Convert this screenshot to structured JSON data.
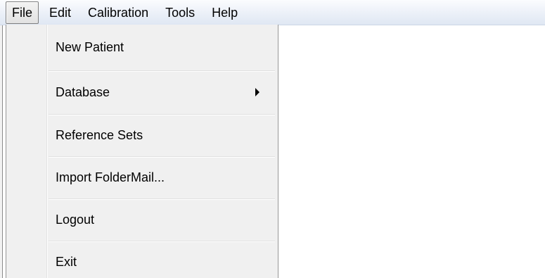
{
  "menubar": {
    "items": [
      {
        "label": "File",
        "active": true
      },
      {
        "label": "Edit"
      },
      {
        "label": "Calibration"
      },
      {
        "label": "Tools"
      },
      {
        "label": "Help"
      }
    ]
  },
  "file_menu": {
    "items": [
      {
        "label": "New Patient"
      },
      {
        "label": "Database",
        "has_submenu": true,
        "submenu_icon": "chevron-right-icon"
      },
      {
        "label": "Reference Sets"
      },
      {
        "label": "Import FolderMail..."
      },
      {
        "label": "Logout"
      },
      {
        "label": "Exit"
      }
    ]
  },
  "colors": {
    "menubar_top": "#fbfcfe",
    "menubar_bottom": "#dfe7f3",
    "dropdown_bg": "#f0f0f0",
    "active_border": "#7f7f7f"
  }
}
